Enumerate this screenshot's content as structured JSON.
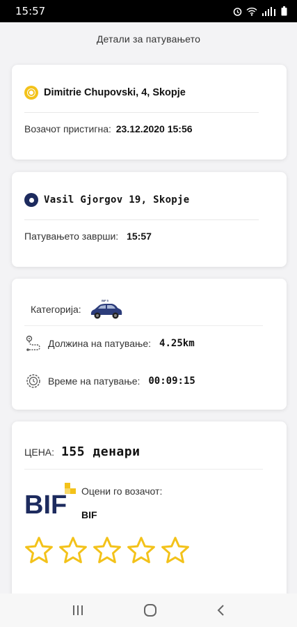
{
  "status_bar": {
    "time": "15:57"
  },
  "page": {
    "title": "Детали за патувањето"
  },
  "pickup": {
    "address": "Dimitrie Chupovski, 4, Skopje",
    "label": "Возачот пристигна:",
    "value": "23.12.2020 15:56"
  },
  "dropoff": {
    "address": "Vasil Gjorgov 19, Skopje",
    "label": "Патувањето заврши:",
    "value": "15:57"
  },
  "trip_info": {
    "category_label": "Категорија:",
    "length_label": "Должина на патување:",
    "length_value": "4.25km",
    "duration_label": "Време на патување:",
    "duration_value": "00:09:15"
  },
  "price": {
    "label": "ЦЕНА:",
    "value": "155 денари",
    "logo_text": "BIF",
    "rate_label": "Оцени го возачот:",
    "company": "BIF",
    "stars_total": 5,
    "stars_selected": 0
  },
  "colors": {
    "accent_yellow": "#f3c21a",
    "brand_navy": "#1d2b5e"
  },
  "icons": [
    "alarm-icon",
    "wifi-icon",
    "signal-icon",
    "battery-icon",
    "route-icon",
    "clock-icon",
    "car-icon",
    "star-icon",
    "recent-apps-icon",
    "home-icon",
    "back-icon"
  ]
}
